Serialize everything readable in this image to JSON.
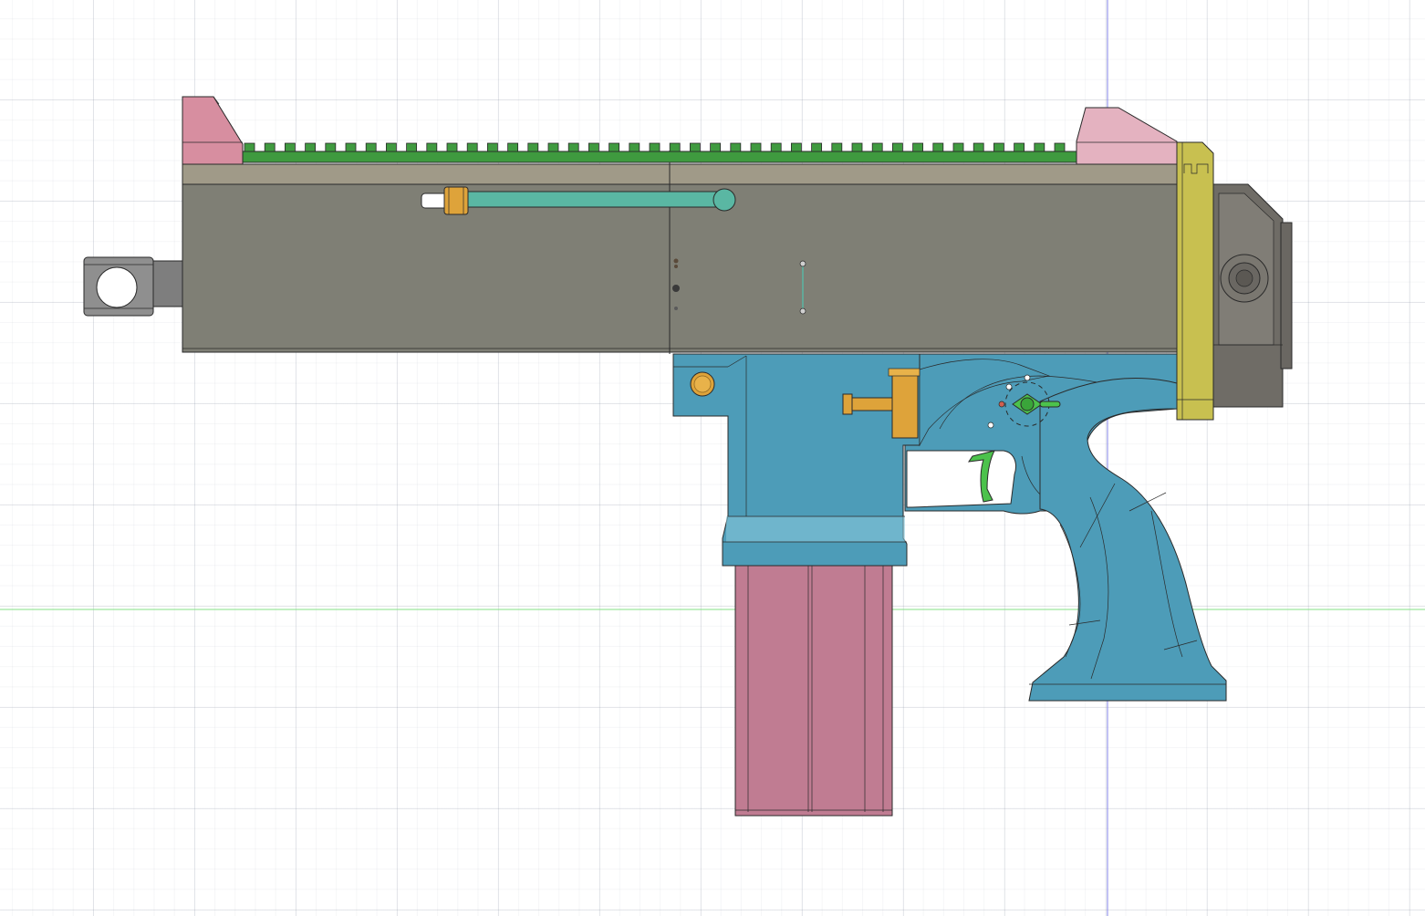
{
  "canvas": {
    "background": "#ffffff",
    "grid_color": "#c9ced8",
    "origin_axis_vertical_color": "#7a7ae6",
    "origin_axis_horizontal_color": "#7be07b"
  },
  "colors": {
    "receiver_gray": "#7f7f75",
    "rail_top_tan": "#a09a88",
    "rail_green": "#3f9a3f",
    "sight_pink": "#d78ea0",
    "sight_pink_light": "#e4b2c0",
    "charging_handle_teal": "#5ab7a3",
    "lower_blue": "#4d9cb8",
    "magazine_pink": "#c07c92",
    "brass_orange": "#dea33a",
    "endcap_yellow": "#c8c050",
    "buffer_gray": "#6f6c66",
    "selector_green": "#4cc24c",
    "barrel_metal": "#8a8a8a"
  },
  "parts": [
    {
      "name": "muzzle-device",
      "icon": "barrel-icon"
    },
    {
      "name": "upper-receiver",
      "icon": "receiver-icon"
    },
    {
      "name": "picatinny-rail",
      "icon": "rail-icon"
    },
    {
      "name": "front-sight",
      "icon": "sight-icon"
    },
    {
      "name": "rear-sight",
      "icon": "sight-icon"
    },
    {
      "name": "charging-handle",
      "icon": "handle-icon"
    },
    {
      "name": "lower-receiver",
      "icon": "lower-icon"
    },
    {
      "name": "magazine",
      "icon": "magazine-icon"
    },
    {
      "name": "pistol-grip",
      "icon": "grip-icon"
    },
    {
      "name": "trigger",
      "icon": "trigger-icon"
    },
    {
      "name": "safety-selector",
      "icon": "selector-icon"
    },
    {
      "name": "magazine-release",
      "icon": "button-icon"
    },
    {
      "name": "end-cap",
      "icon": "cap-icon"
    },
    {
      "name": "buffer-tube-adapter",
      "icon": "buffer-icon"
    }
  ]
}
